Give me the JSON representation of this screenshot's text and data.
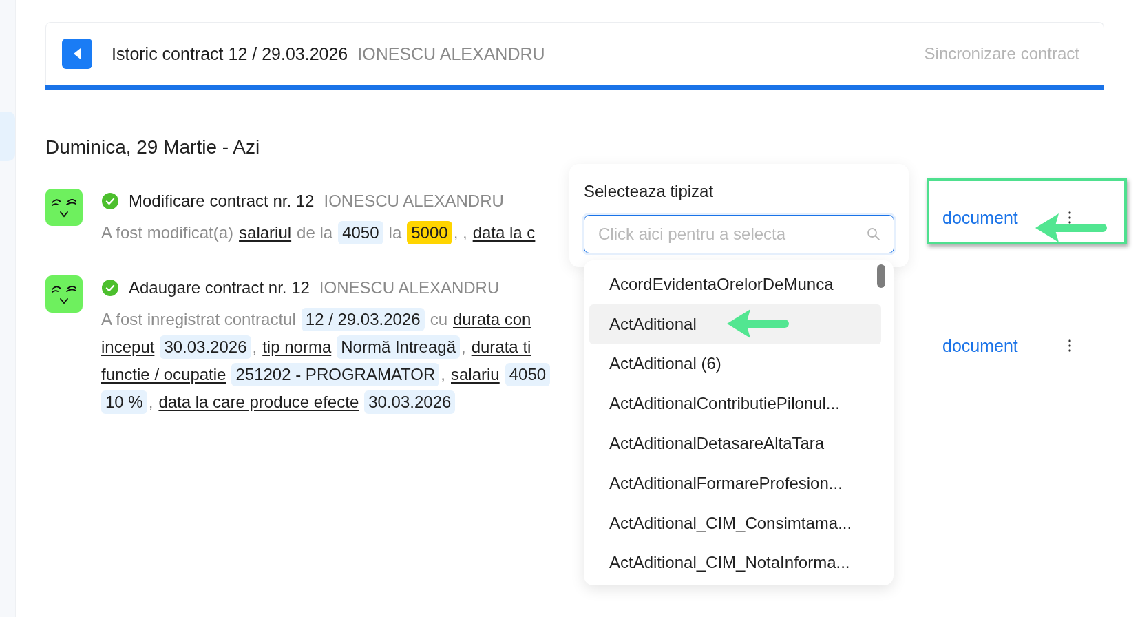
{
  "header": {
    "title": "Istoric contract 12 / 29.03.2026",
    "subtitle": "IONESCU ALEXANDRU",
    "action": "Sincronizare contract"
  },
  "day_heading": "Duminica, 29 Martie - Azi",
  "entries": [
    {
      "title": "Modificare contract nr. 12",
      "person": "IONESCU ALEXANDRU",
      "done": true,
      "link": "document",
      "lines": [
        [
          {
            "kind": "plain",
            "text": "A fost modificat(a)"
          },
          {
            "kind": "link",
            "text": "salariul"
          },
          {
            "kind": "plain",
            "text": "de la"
          },
          {
            "kind": "value",
            "text": "4050"
          },
          {
            "kind": "plain",
            "text": "la"
          },
          {
            "kind": "highlight",
            "text": "5000"
          },
          {
            "kind": "punct",
            "text": ", ,"
          },
          {
            "kind": "link",
            "text": "data la c"
          }
        ]
      ]
    },
    {
      "title": "Adaugare contract nr. 12",
      "person": "IONESCU ALEXANDRU",
      "done": true,
      "link": "document",
      "lines": [
        [
          {
            "kind": "plain",
            "text": "A fost inregistrat contractul"
          },
          {
            "kind": "value",
            "text": "12 / 29.03.2026"
          },
          {
            "kind": "plain",
            "text": "cu"
          },
          {
            "kind": "link",
            "text": "durata con"
          }
        ],
        [
          {
            "kind": "link",
            "text": "inceput"
          },
          {
            "kind": "value",
            "text": "30.03.2026"
          },
          {
            "kind": "punct",
            "text": ","
          },
          {
            "kind": "link",
            "text": "tip norma"
          },
          {
            "kind": "value",
            "text": "Normă Intreagă"
          },
          {
            "kind": "punct",
            "text": ","
          },
          {
            "kind": "link",
            "text": "durata ti"
          }
        ],
        [
          {
            "kind": "link",
            "text": "functie / ocupatie"
          },
          {
            "kind": "value",
            "text": "251202 - PROGRAMATOR"
          },
          {
            "kind": "punct",
            "text": ","
          },
          {
            "kind": "link",
            "text": "salariu"
          },
          {
            "kind": "value",
            "text": "4050"
          }
        ],
        [
          {
            "kind": "value",
            "text": "10 %"
          },
          {
            "kind": "punct",
            "text": ","
          },
          {
            "kind": "link",
            "text": "data la care produce efecte"
          },
          {
            "kind": "value",
            "text": "30.03.2026"
          }
        ]
      ]
    }
  ],
  "picker": {
    "title": "Selecteaza tipizat",
    "search": {
      "placeholder": "Click aici pentru a selecta"
    },
    "options": [
      {
        "label": "AcordEvidentaOrelorDeMunca",
        "selected": false
      },
      {
        "label": "ActAditional",
        "selected": true
      },
      {
        "label": "ActAditional (6)",
        "selected": false
      },
      {
        "label": "ActAditionalContributiePilonul...",
        "selected": false
      },
      {
        "label": "ActAditionalDetasareAltaTara",
        "selected": false
      },
      {
        "label": "ActAditionalFormareProfesion...",
        "selected": false
      },
      {
        "label": "ActAditional_CIM_Consimtama...",
        "selected": false
      },
      {
        "label": "ActAditional_CIM_NotaInforma...",
        "selected": false
      }
    ]
  }
}
